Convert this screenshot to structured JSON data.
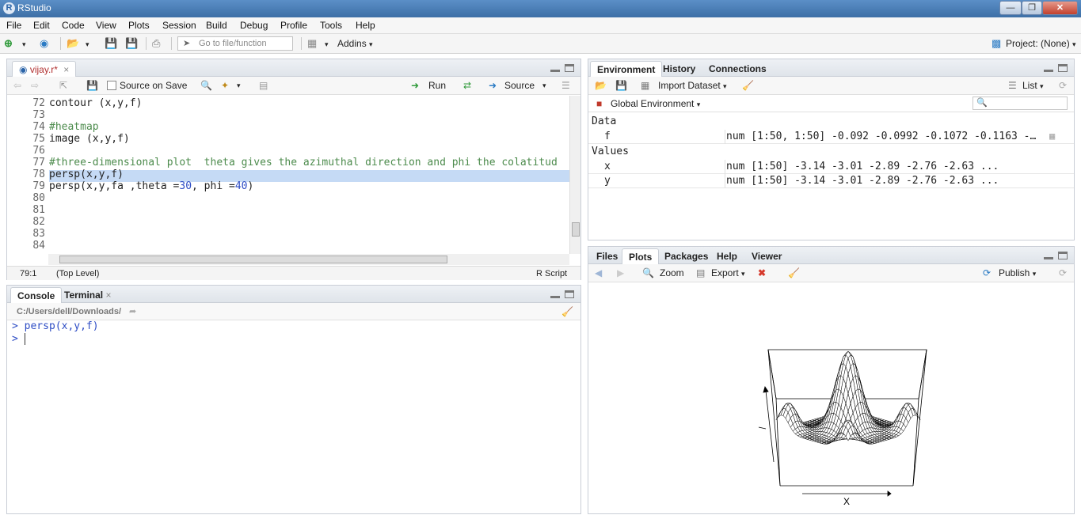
{
  "window": {
    "title": "RStudio",
    "app_icon": "R"
  },
  "menu": [
    "File",
    "Edit",
    "Code",
    "View",
    "Plots",
    "Session",
    "Build",
    "Debug",
    "Profile",
    "Tools",
    "Help"
  ],
  "toolbar": {
    "goto_placeholder": "Go to file/function",
    "addins": "Addins",
    "project": "Project: (None)"
  },
  "editor": {
    "tab": "vijay.r*",
    "source_on_save": "Source on Save",
    "run": "Run",
    "source": "Source",
    "lines": [
      {
        "n": "72",
        "text": "contour (x,y,f)",
        "type": "code"
      },
      {
        "n": "73",
        "text": "",
        "type": "code"
      },
      {
        "n": "74",
        "text": "#heatmap",
        "type": "comment"
      },
      {
        "n": "75",
        "text": "image (x,y,f)",
        "type": "code"
      },
      {
        "n": "76",
        "text": "",
        "type": "code"
      },
      {
        "n": "77",
        "text": "#three-dimensional plot  theta gives the azimuthal direction and phi the colatitud",
        "type": "comment"
      },
      {
        "n": "78",
        "text": "persp(x,y,f)",
        "type": "code"
      },
      {
        "n": "79",
        "pre": "persp(x,y,fa ,theta =",
        "n1": "30",
        "mid": ", phi =",
        "n2": "40",
        "post": ")",
        "type": "mixed"
      },
      {
        "n": "80",
        "text": "",
        "type": "code"
      },
      {
        "n": "81",
        "text": "",
        "type": "code"
      },
      {
        "n": "82",
        "text": "",
        "type": "code"
      },
      {
        "n": "83",
        "text": "",
        "type": "code"
      },
      {
        "n": "84",
        "text": "",
        "type": "code"
      }
    ],
    "status_pos": "79:1",
    "status_scope": "(Top Level)",
    "status_type": "R Script"
  },
  "console": {
    "tabs": [
      "Console",
      "Terminal"
    ],
    "path": "C:/Users/dell/Downloads/",
    "prompt": ">",
    "history": "persp(x,y,f)"
  },
  "environment": {
    "tabs": [
      "Environment",
      "History",
      "Connections"
    ],
    "import": "Import Dataset",
    "view_mode": "List",
    "scope": "Global Environment",
    "data_header": "Data",
    "values_header": "Values",
    "data": [
      {
        "name": "f",
        "value": "num [1:50, 1:50] -0.092 -0.0992 -0.1072 -0.1163 -…"
      }
    ],
    "values": [
      {
        "name": "x",
        "value": "num [1:50] -3.14 -3.01 -2.89 -2.76 -2.63 ..."
      },
      {
        "name": "y",
        "value": "num [1:50] -3.14 -3.01 -2.89 -2.76 -2.63 ..."
      }
    ]
  },
  "files_pane": {
    "tabs": [
      "Files",
      "Plots",
      "Packages",
      "Help",
      "Viewer"
    ],
    "zoom": "Zoom",
    "export": "Export",
    "publish": "Publish",
    "plot_xlabel": "X"
  }
}
